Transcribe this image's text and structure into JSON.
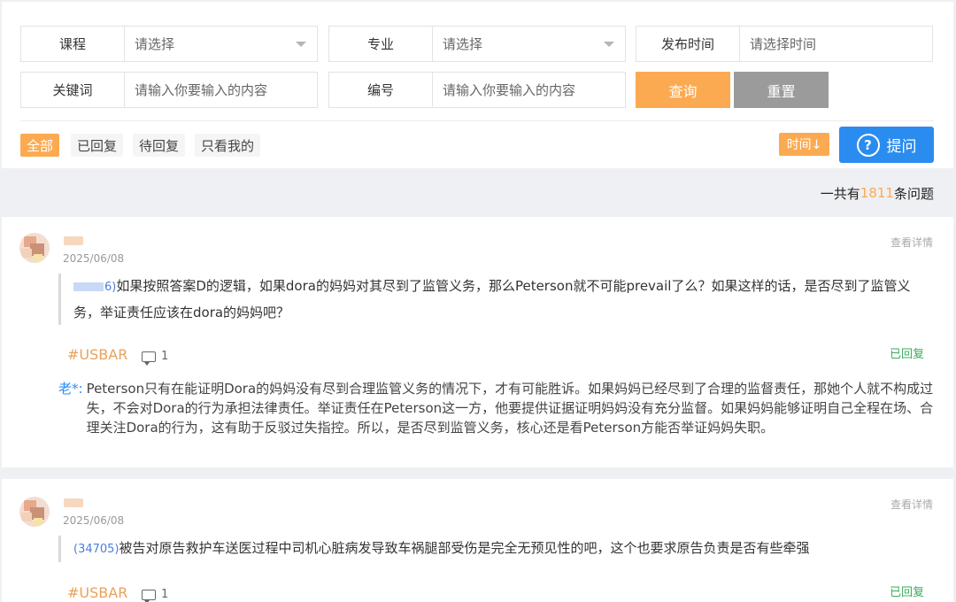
{
  "filters": {
    "course": {
      "label": "课程",
      "placeholder": "请选择"
    },
    "major": {
      "label": "专业",
      "placeholder": "请选择"
    },
    "publish_time": {
      "label": "发布时间",
      "placeholder": "请选择时间"
    },
    "keyword": {
      "label": "关键词",
      "placeholder": "请输入你要输入的内容"
    },
    "number": {
      "label": "编号",
      "placeholder": "请输入你要输入的内容"
    },
    "search_label": "查询",
    "reset_label": "重置"
  },
  "tabs": [
    {
      "label": "全部",
      "active": true
    },
    {
      "label": "已回复",
      "active": false
    },
    {
      "label": "待回复",
      "active": false
    },
    {
      "label": "只看我的",
      "active": false
    }
  ],
  "sort_label": "时间↓",
  "ask_label": "提问",
  "ask_icon": "question-circle-icon",
  "total": {
    "prefix": "一共有",
    "count": "1811",
    "suffix": "条问题"
  },
  "questions": [
    {
      "date": "2025/06/08",
      "detail_label": "查看详情",
      "ref": "6)",
      "text": "如果按照答案D的逻辑，如果dora的妈妈对其尽到了监管义务，那么Peterson就不可能prevail了么？如果这样的话，是否尽到了监管义务，举证责任应该在dora的妈妈吧？",
      "tag": "#USBAR",
      "comments": "1",
      "status": "已回复",
      "answer_author": "老*:",
      "answer": "Peterson只有在能证明Dora的妈妈没有尽到合理监管义务的情况下，才有可能胜诉。如果妈妈已经尽到了合理的监督责任，那她个人就不构成过失，不会对Dora的行为承担法律责任。举证责任在Peterson这一方，他要提供证据证明妈妈没有充分监督。如果妈妈能够证明自己全程在场、合理关注Dora的行为，这有助于反驳过失指控。所以，是否尽到监管义务，核心还是看Peterson方能否举证妈妈失职。"
    },
    {
      "date": "2025/06/08",
      "detail_label": "查看详情",
      "ref": "(34705)",
      "text": "被告对原告救护车送医过程中司机心脏病发导致车祸腿部受伤是完全无预见性的吧，这个也要求原告负责是否有些牵强",
      "tag": "#USBAR",
      "comments": "1",
      "status": "已回复"
    }
  ],
  "colors": {
    "accent_orange": "#fcaa52",
    "primary_blue": "#2b8cf0",
    "replied_green": "#3aab5c",
    "reset_gray": "#9b9b9b"
  }
}
